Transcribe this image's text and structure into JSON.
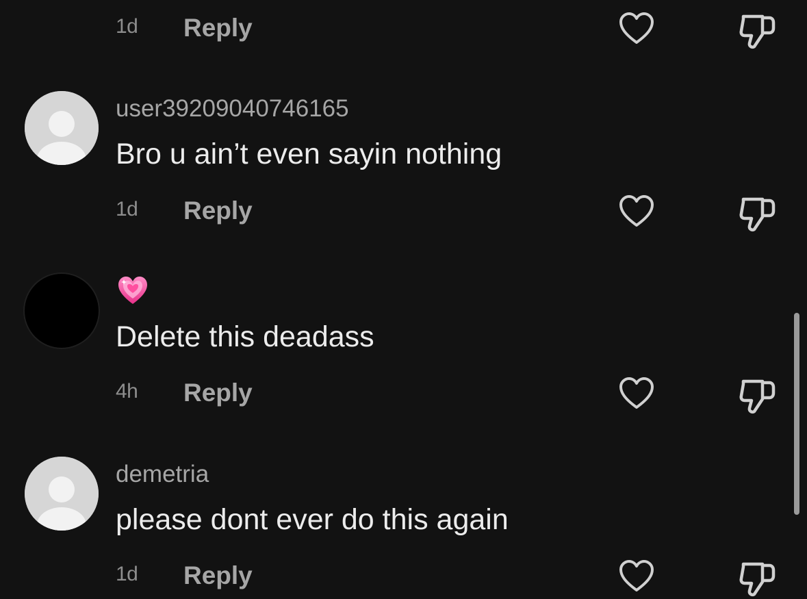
{
  "comments": [
    {
      "username": "user39209040746165",
      "text": "Bro u ain’t even sayin nothing",
      "time": "1d",
      "reply_label": "Reply",
      "avatar": "default-avatar"
    },
    {
      "username": "",
      "username_icon": "pink-sparkling-heart-emoji",
      "text": "Delete this deadass",
      "time": "4h",
      "reply_label": "Reply",
      "avatar": "black-avatar"
    },
    {
      "username": "demetria",
      "text": "please dont ever do this again",
      "time": "1d",
      "reply_label": "Reply",
      "avatar": "default-avatar"
    }
  ],
  "top_row": {
    "time": "1d",
    "reply_label": "Reply"
  },
  "icons": {
    "like": "heart-outline-icon",
    "dislike": "thumbs-down-outline-icon"
  },
  "colors": {
    "background": "#121212",
    "text_primary": "#ececec",
    "text_secondary": "#a6a6a6",
    "emoji_pink": "#ff5fa8"
  }
}
